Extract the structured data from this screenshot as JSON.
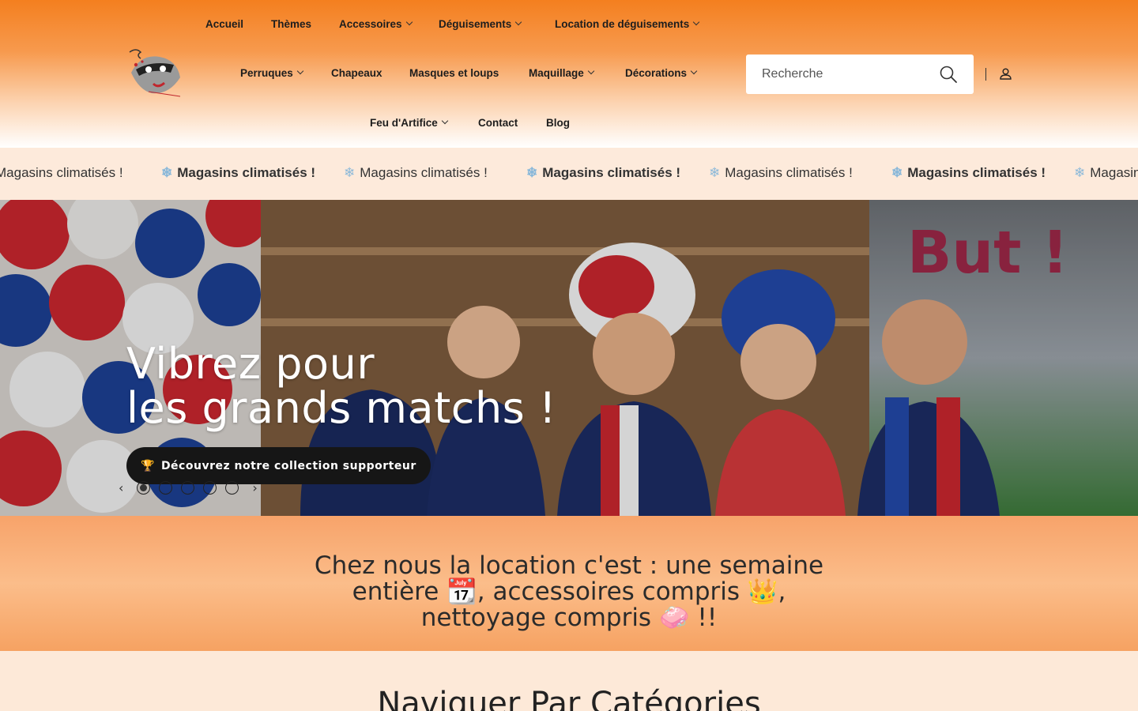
{
  "nav": {
    "row1": [
      {
        "label": "Accueil",
        "dropdown": false
      },
      {
        "label": "Thèmes",
        "dropdown": false
      },
      {
        "label": "Accessoires",
        "dropdown": true
      },
      {
        "label": "Déguisements",
        "dropdown": true
      },
      {
        "label": "Location de déguisements",
        "dropdown": true
      }
    ],
    "row2": [
      {
        "label": "Perruques",
        "dropdown": true
      },
      {
        "label": "Chapeaux",
        "dropdown": false
      },
      {
        "label": "Masques et loups",
        "dropdown": false
      },
      {
        "label": "Maquillage",
        "dropdown": true
      },
      {
        "label": "Décorations",
        "dropdown": true
      }
    ],
    "row3": [
      {
        "label": "Feu d'Artifice",
        "dropdown": true
      },
      {
        "label": "Contact",
        "dropdown": false
      },
      {
        "label": "Blog",
        "dropdown": false
      }
    ]
  },
  "search": {
    "placeholder": "Recherche"
  },
  "marquee": {
    "text": "Magasins climatisés !",
    "icon": "snowflake-icon"
  },
  "hero": {
    "title_line1": "Vibrez pour",
    "title_line2": "les grands matchs !",
    "button_icon": "🏆",
    "button_label": "Découvrez notre collection supporteur",
    "background_text": "But !",
    "slides": 5,
    "active_slide": 1
  },
  "banner": {
    "text": "Chez nous la location c'est : une semaine entière 📆, accessoires compris 👑, nettoyage compris 🧼 !!"
  },
  "categories": {
    "title": "Naviguer Par Catégories"
  },
  "colors": {
    "header_orange": "#f47f1f",
    "banner_orange": "#f7a36a",
    "page_bg": "#fde9d8",
    "button_dark": "#161616"
  }
}
